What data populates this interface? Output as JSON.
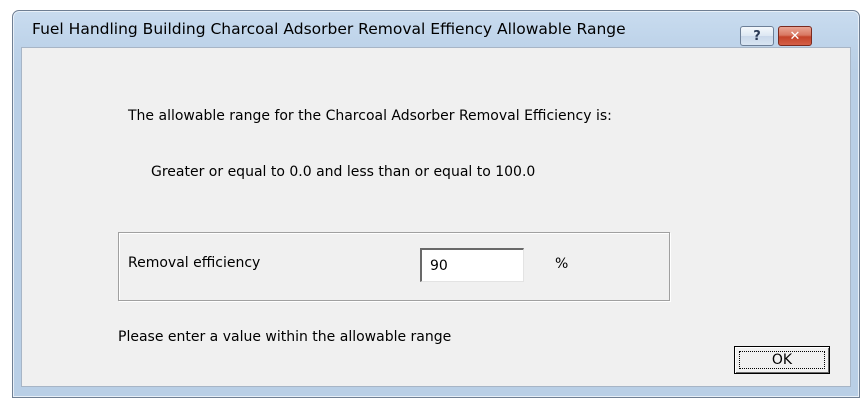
{
  "window": {
    "title": "Fuel Handling Building Charcoal Adsorber Removal Effiency Allowable Range",
    "help_icon": "?",
    "close_icon": "✕"
  },
  "dialog": {
    "intro": "The allowable range for the Charcoal Adsorber Removal Efficiency is:",
    "range": "Greater or equal to 0.0 and less than or equal to 100.0",
    "field_label": "Removal efficiency",
    "field_value": "90",
    "unit": "%",
    "message": "Please enter a value within the allowable range",
    "ok_label": "OK"
  }
}
